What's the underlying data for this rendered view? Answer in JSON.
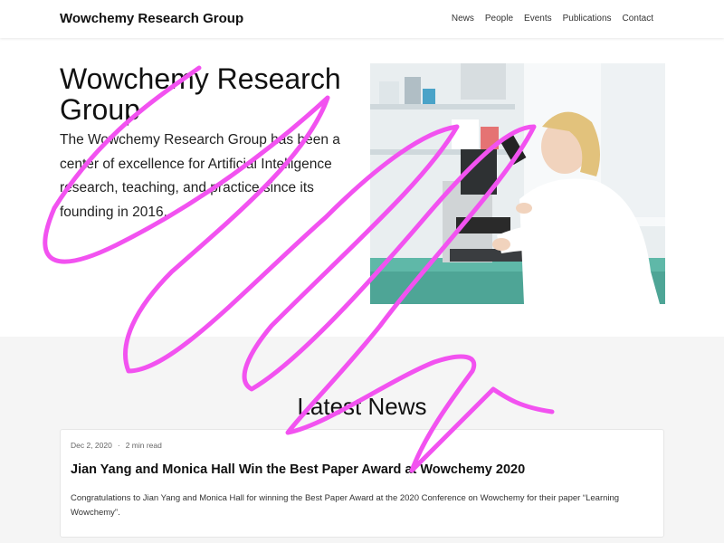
{
  "navbar": {
    "brand": "Wowchemy Research Group",
    "links": [
      "News",
      "People",
      "Events",
      "Publications",
      "Contact"
    ]
  },
  "hero": {
    "title": "Wowchemy Research Group",
    "text": "The Wowchemy Research Group has been a center of excellence for Artificial Intelligence research, teaching, and practice since its founding in 2016."
  },
  "news": {
    "heading": "Latest News",
    "items": [
      {
        "date": "Dec 2, 2020",
        "separator": "·",
        "read_time": "2 min read",
        "title": "Jian Yang and Monica Hall Win the Best Paper Award at Wowchemy 2020",
        "summary": "Congratulations to Jian Yang and Monica Hall for winning the Best Paper Award at the 2020 Conference on Wowchemy for their paper “Learning Wowchemy”."
      }
    ]
  },
  "colors": {
    "annotation_stroke": "#f252f0",
    "section_background": "#f5f5f5"
  }
}
